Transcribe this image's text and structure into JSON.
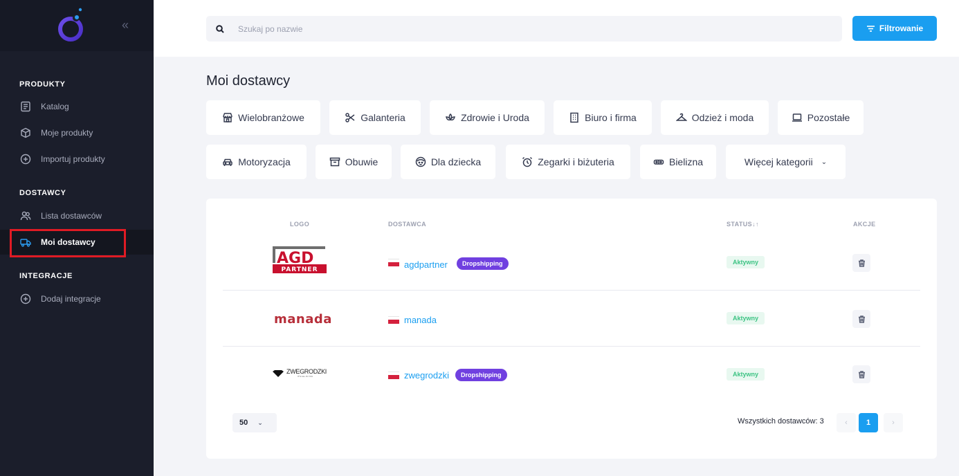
{
  "sidebar": {
    "collapse_glyph": "«",
    "sections": [
      {
        "title": "PRODUKTY",
        "items": [
          {
            "label": "Katalog",
            "icon": "catalog-icon"
          },
          {
            "label": "Moje produkty",
            "icon": "box-icon"
          },
          {
            "label": "Importuj produkty",
            "icon": "plus-circle-icon"
          }
        ]
      },
      {
        "title": "DOSTAWCY",
        "items": [
          {
            "label": "Lista dostawców",
            "icon": "users-icon"
          },
          {
            "label": "Moi dostawcy",
            "icon": "truck-icon",
            "active": true
          }
        ]
      },
      {
        "title": "INTEGRACJE",
        "items": [
          {
            "label": "Dodaj integracje",
            "icon": "plus-circle-icon"
          }
        ]
      }
    ]
  },
  "header": {
    "search_placeholder": "Szukaj po nazwie",
    "filter_label": "Filtrowanie"
  },
  "main": {
    "title": "Moi dostawcy",
    "categories": [
      {
        "label": "Wielobranżowe",
        "icon": "store-icon"
      },
      {
        "label": "Galanteria",
        "icon": "scissors-icon"
      },
      {
        "label": "Zdrowie i Uroda",
        "icon": "lotus-icon"
      },
      {
        "label": "Biuro i firma",
        "icon": "building-icon"
      },
      {
        "label": "Odzież i moda",
        "icon": "hanger-icon"
      },
      {
        "label": "Pozostałe",
        "icon": "laptop-icon"
      },
      {
        "label": "Motoryzacja",
        "icon": "car-icon"
      },
      {
        "label": "Obuwie",
        "icon": "archive-icon"
      },
      {
        "label": "Dla dziecka",
        "icon": "baby-face-icon"
      },
      {
        "label": "Zegarki i biżuteria",
        "icon": "alarm-clock-icon"
      },
      {
        "label": "Bielizna",
        "icon": "glasses-icon"
      },
      {
        "label": "Więcej kategorii",
        "icon": "chevron-down-icon"
      }
    ],
    "table": {
      "headers": {
        "logo": "LOGO",
        "supplier": "DOSTAWCA",
        "status": "STATUS",
        "actions": "AKCJE"
      },
      "status_sort_glyph": "↓↑",
      "rows": [
        {
          "logo_top": "AGD",
          "logo_bottom": "PARTNER",
          "name": "agdpartner",
          "badge": "Dropshipping",
          "status": "Aktywny"
        },
        {
          "logo_text": "manada",
          "name": "manada",
          "badge": "",
          "status": "Aktywny"
        },
        {
          "logo_text": "ZWEGRODZKI",
          "logo_sub": "IT'S ALL IN YOU",
          "name": "zwegrodzki",
          "badge": "Dropshipping",
          "status": "Aktywny"
        }
      ]
    },
    "footer": {
      "per_page": "50",
      "per_page_chevron": "⌄",
      "total_text": "Wszystkich dostawców: 3",
      "page_prev": "‹",
      "current_page": "1",
      "page_next": "›"
    }
  },
  "colors": {
    "accent": "#1a9ef0",
    "sidebar_bg": "#1b1e2b",
    "badge_purple": "#7040e0",
    "status_green": "#3cc383",
    "highlight_red": "#e01b24"
  }
}
